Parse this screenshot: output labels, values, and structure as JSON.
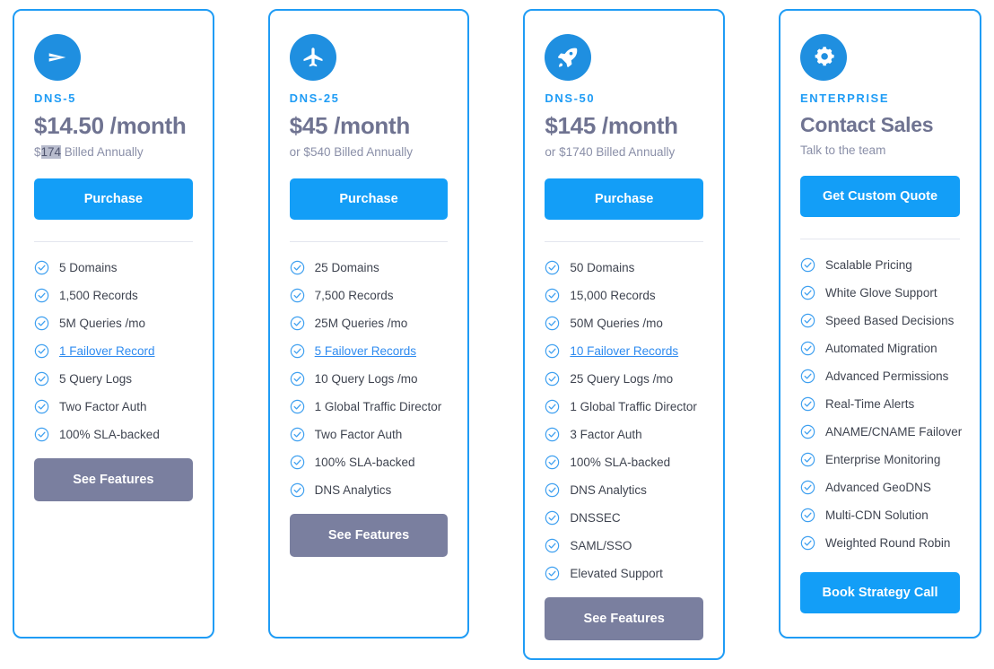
{
  "cards": [
    {
      "icon": "paper-plane-icon",
      "plan_name": "DNS-5",
      "price": "$14.50 /month",
      "billing_prefix": "$",
      "billing_amount": "174",
      "billing_suffix": " Billed Annually",
      "cta_label": "Purchase",
      "features": [
        {
          "label": "5 Domains",
          "link": false
        },
        {
          "label": "1,500 Records",
          "link": false
        },
        {
          "label": "5M Queries /mo",
          "link": false
        },
        {
          "label": "1 Failover Record",
          "link": true
        },
        {
          "label": "5 Query Logs",
          "link": false
        },
        {
          "label": "Two Factor Auth",
          "link": false
        },
        {
          "label": "100% SLA-backed",
          "link": false
        }
      ],
      "see_features_label": "See Features"
    },
    {
      "icon": "airplane-icon",
      "plan_name": "DNS-25",
      "price": "$45 /month",
      "billing_prefix": "or $",
      "billing_amount": "540",
      "billing_suffix": " Billed Annually",
      "cta_label": "Purchase",
      "features": [
        {
          "label": "25 Domains",
          "link": false
        },
        {
          "label": "7,500 Records",
          "link": false
        },
        {
          "label": "25M Queries /mo",
          "link": false
        },
        {
          "label": "5 Failover Records",
          "link": true
        },
        {
          "label": "10 Query Logs /mo",
          "link": false
        },
        {
          "label": "1 Global Traffic Director",
          "link": false
        },
        {
          "label": "Two Factor Auth",
          "link": false
        },
        {
          "label": "100% SLA-backed",
          "link": false
        },
        {
          "label": "DNS Analytics",
          "link": false
        }
      ],
      "see_features_label": "See Features"
    },
    {
      "icon": "rocket-icon",
      "plan_name": "DNS-50",
      "price": "$145 /month",
      "billing_prefix": "or $",
      "billing_amount": "1740",
      "billing_suffix": " Billed Annually",
      "cta_label": "Purchase",
      "features": [
        {
          "label": "50 Domains",
          "link": false
        },
        {
          "label": "15,000 Records",
          "link": false
        },
        {
          "label": "50M Queries /mo",
          "link": false
        },
        {
          "label": "10 Failover Records",
          "link": true
        },
        {
          "label": "25 Query Logs /mo",
          "link": false
        },
        {
          "label": "1 Global Traffic Director",
          "link": false
        },
        {
          "label": "3 Factor Auth",
          "link": false
        },
        {
          "label": "100% SLA-backed",
          "link": false
        },
        {
          "label": "DNS Analytics",
          "link": false
        },
        {
          "label": "DNSSEC",
          "link": false
        },
        {
          "label": "SAML/SSO",
          "link": false
        },
        {
          "label": "Elevated Support",
          "link": false
        }
      ],
      "see_features_label": "See Features"
    },
    {
      "icon": "gears-icon",
      "plan_name": "ENTERPRISE",
      "contact_title": "Contact Sales",
      "contact_sub": "Talk to the team",
      "cta_label": "Get Custom Quote",
      "features": [
        {
          "label": "Scalable Pricing",
          "link": false
        },
        {
          "label": "White Glove Support",
          "link": false
        },
        {
          "label": "Speed Based Decisions",
          "link": false
        },
        {
          "label": "Automated Migration",
          "link": false
        },
        {
          "label": "Advanced Permissions",
          "link": false
        },
        {
          "label": "Real-Time Alerts",
          "link": false
        },
        {
          "label": "ANAME/CNAME Failover",
          "link": false
        },
        {
          "label": "Enterprise Monitoring",
          "link": false
        },
        {
          "label": "Advanced GeoDNS",
          "link": false
        },
        {
          "label": "Multi-CDN Solution",
          "link": false
        },
        {
          "label": "Weighted Round Robin",
          "link": false
        }
      ],
      "bottom_cta_label": "Book Strategy Call"
    }
  ],
  "colors": {
    "brand_blue": "#139ef7",
    "icon_blue": "#1f8fe0",
    "border_blue": "#1f9cf5",
    "slate": "#6f7391",
    "secondary_button": "#7a7f9f",
    "link_blue": "#2e8bf0"
  }
}
